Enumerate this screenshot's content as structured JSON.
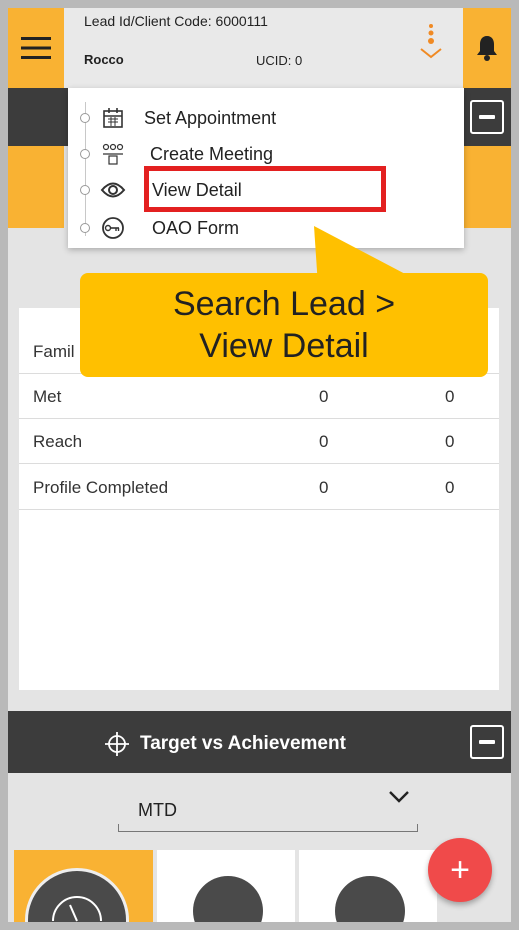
{
  "header": {
    "lead_id": "Lead Id/Client Code: 6000111",
    "client_name": "Rocco",
    "ucid": "UCID: 0"
  },
  "menu": {
    "items": [
      {
        "label": "Set Appointment",
        "icon": "calendar-icon"
      },
      {
        "label": "Create Meeting",
        "icon": "people-group-icon"
      },
      {
        "label": "View Detail",
        "icon": "eye-icon"
      },
      {
        "label": "OAO Form",
        "icon": "key-icon"
      }
    ],
    "highlighted": "View Detail"
  },
  "callout": {
    "line1": "Search Lead >",
    "line2": "View Detail"
  },
  "table": {
    "rows": [
      {
        "label": "Famil",
        "v1": "",
        "v2": ""
      },
      {
        "label": "Met",
        "v1": "0",
        "v2": "0"
      },
      {
        "label": "Reach",
        "v1": "0",
        "v2": "0"
      },
      {
        "label": "Profile Completed",
        "v1": "0",
        "v2": "0"
      }
    ]
  },
  "target": {
    "title": "Target vs Achievement"
  },
  "period": {
    "selected": "MTD"
  },
  "fab": {
    "label": "+"
  },
  "colors": {
    "accent": "#f9b233",
    "dark_bar": "#3c3c3c",
    "highlight": "#e32020",
    "callout": "#ffc000",
    "fab": "#f04a4a"
  }
}
